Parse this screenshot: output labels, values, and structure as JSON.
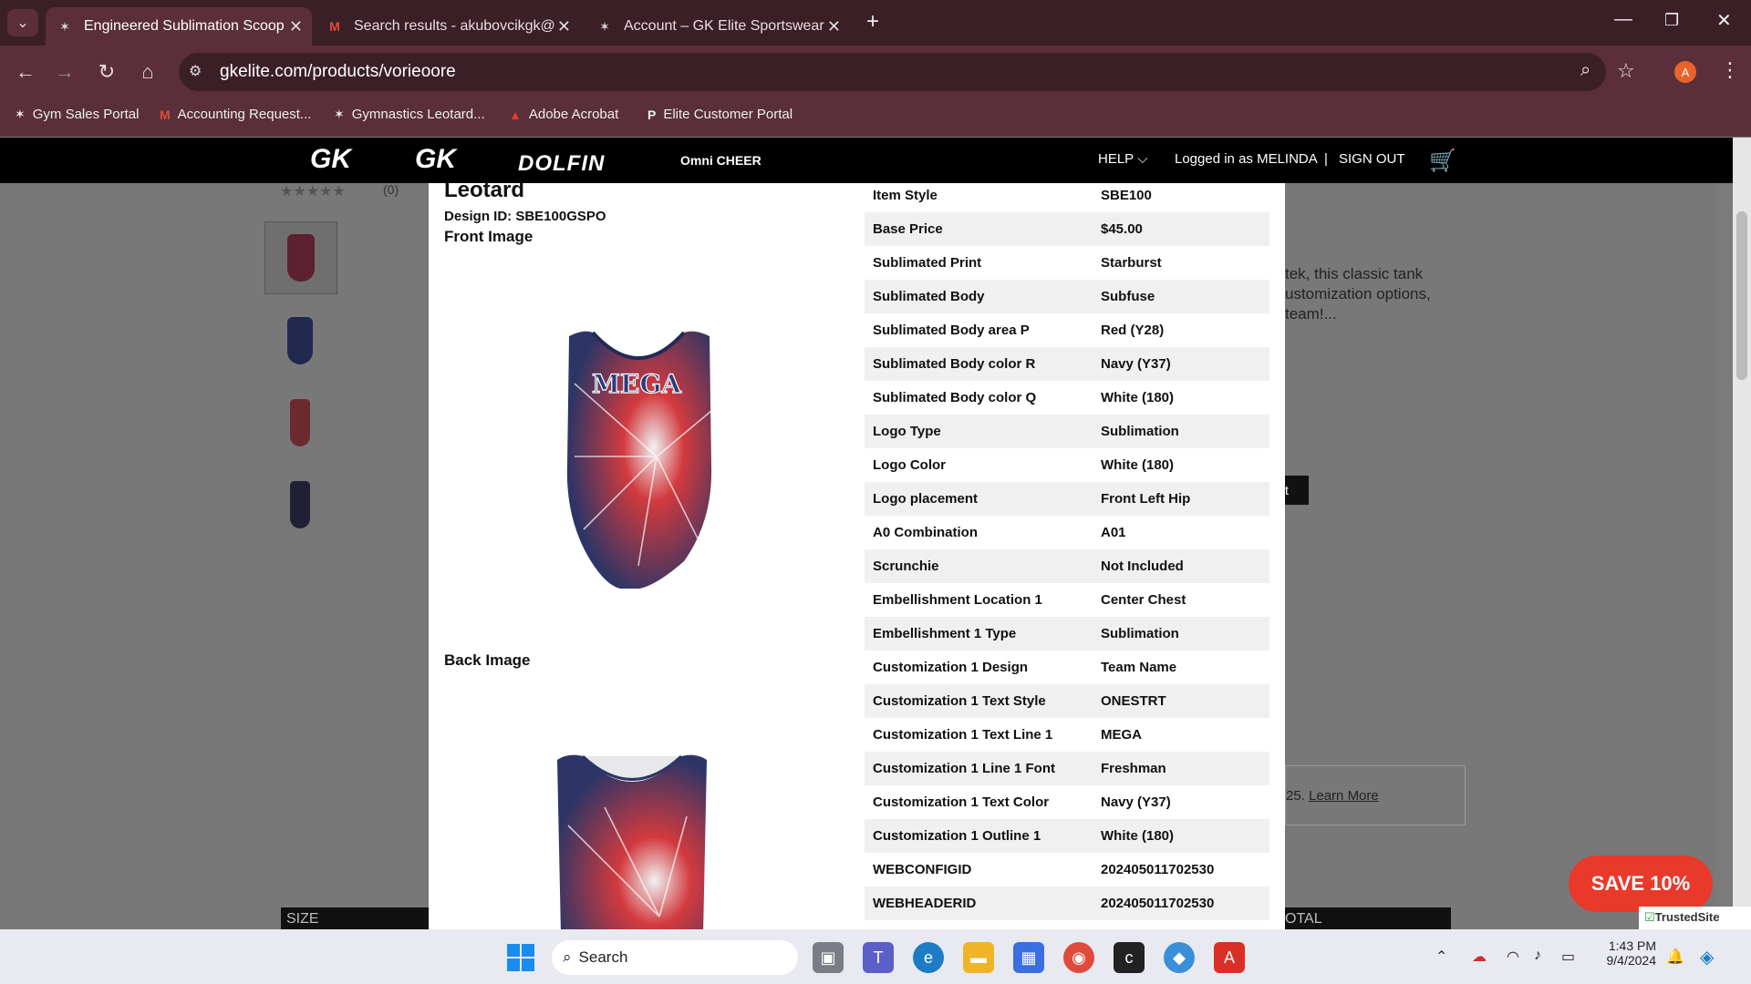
{
  "browser": {
    "tabs": [
      {
        "title": "Engineered Sublimation Scoop",
        "icon": "gk-icon"
      },
      {
        "title": "Search results - akubovcikgk@",
        "icon": "gmail-icon"
      },
      {
        "title": "Account – GK Elite Sportswear",
        "icon": "gk-icon"
      }
    ],
    "url": "gkelite.com/products/vorieoore",
    "bookmarks": [
      "Gym Sales Portal",
      "Accounting Request...",
      "Gymnastics Leotard...",
      "Adobe Acrobat",
      "Elite Customer Portal"
    ],
    "profile_initial": "A"
  },
  "site": {
    "brands": [
      "GK",
      "GK",
      "DOLFIN",
      "Omni CHEER"
    ],
    "help": "HELP",
    "logged_in": "Logged in as MELINDA",
    "sign_out": "SIGN OUT",
    "rating_count": "(0)",
    "bg_text_1": "tek, this classic tank",
    "bg_text_2": "ustomization options,",
    "bg_text_3": "team!...",
    "bg_offer": "25.",
    "bg_learn_more": "Learn More",
    "size_label": "SIZE",
    "total_label": "OTAL"
  },
  "modal": {
    "title": "Leotard",
    "design_id": "Design ID: SBE100GSPO",
    "front_label": "Front Image",
    "back_label": "Back Image",
    "leotard_text": "MEGA",
    "specs": [
      [
        "Item Style",
        "SBE100"
      ],
      [
        "Base Price",
        "$45.00"
      ],
      [
        "Sublimated Print",
        "Starburst"
      ],
      [
        "Sublimated Body",
        "Subfuse"
      ],
      [
        "Sublimated Body area P",
        "Red (Y28)"
      ],
      [
        "Sublimated Body color R",
        "Navy (Y37)"
      ],
      [
        "Sublimated Body color Q",
        "White (180)"
      ],
      [
        "Logo Type",
        "Sublimation"
      ],
      [
        "Logo Color",
        "White (180)"
      ],
      [
        "Logo placement",
        "Front Left Hip"
      ],
      [
        "A0 Combination",
        "A01"
      ],
      [
        "Scrunchie",
        "Not Included"
      ],
      [
        "Embellishment Location 1",
        "Center Chest"
      ],
      [
        "Embellishment 1 Type",
        "Sublimation"
      ],
      [
        "Customization 1 Design",
        "Team Name"
      ],
      [
        "Customization 1 Text Style",
        "ONESTRT"
      ],
      [
        "Customization 1 Text Line 1",
        "MEGA"
      ],
      [
        "Customization 1 Line 1 Font",
        "Freshman"
      ],
      [
        "Customization 1 Text Color",
        "Navy (Y37)"
      ],
      [
        "Customization 1 Outline 1",
        "White (180)"
      ],
      [
        "WEBCONFIGID",
        "202405011702530"
      ],
      [
        "WEBHEADERID",
        "202405011702530"
      ]
    ]
  },
  "save_badge": "SAVE 10%",
  "trusted_site": "TrustedSite",
  "taskbar": {
    "search": "Search",
    "time": "1:43 PM",
    "date": "9/4/2024"
  }
}
